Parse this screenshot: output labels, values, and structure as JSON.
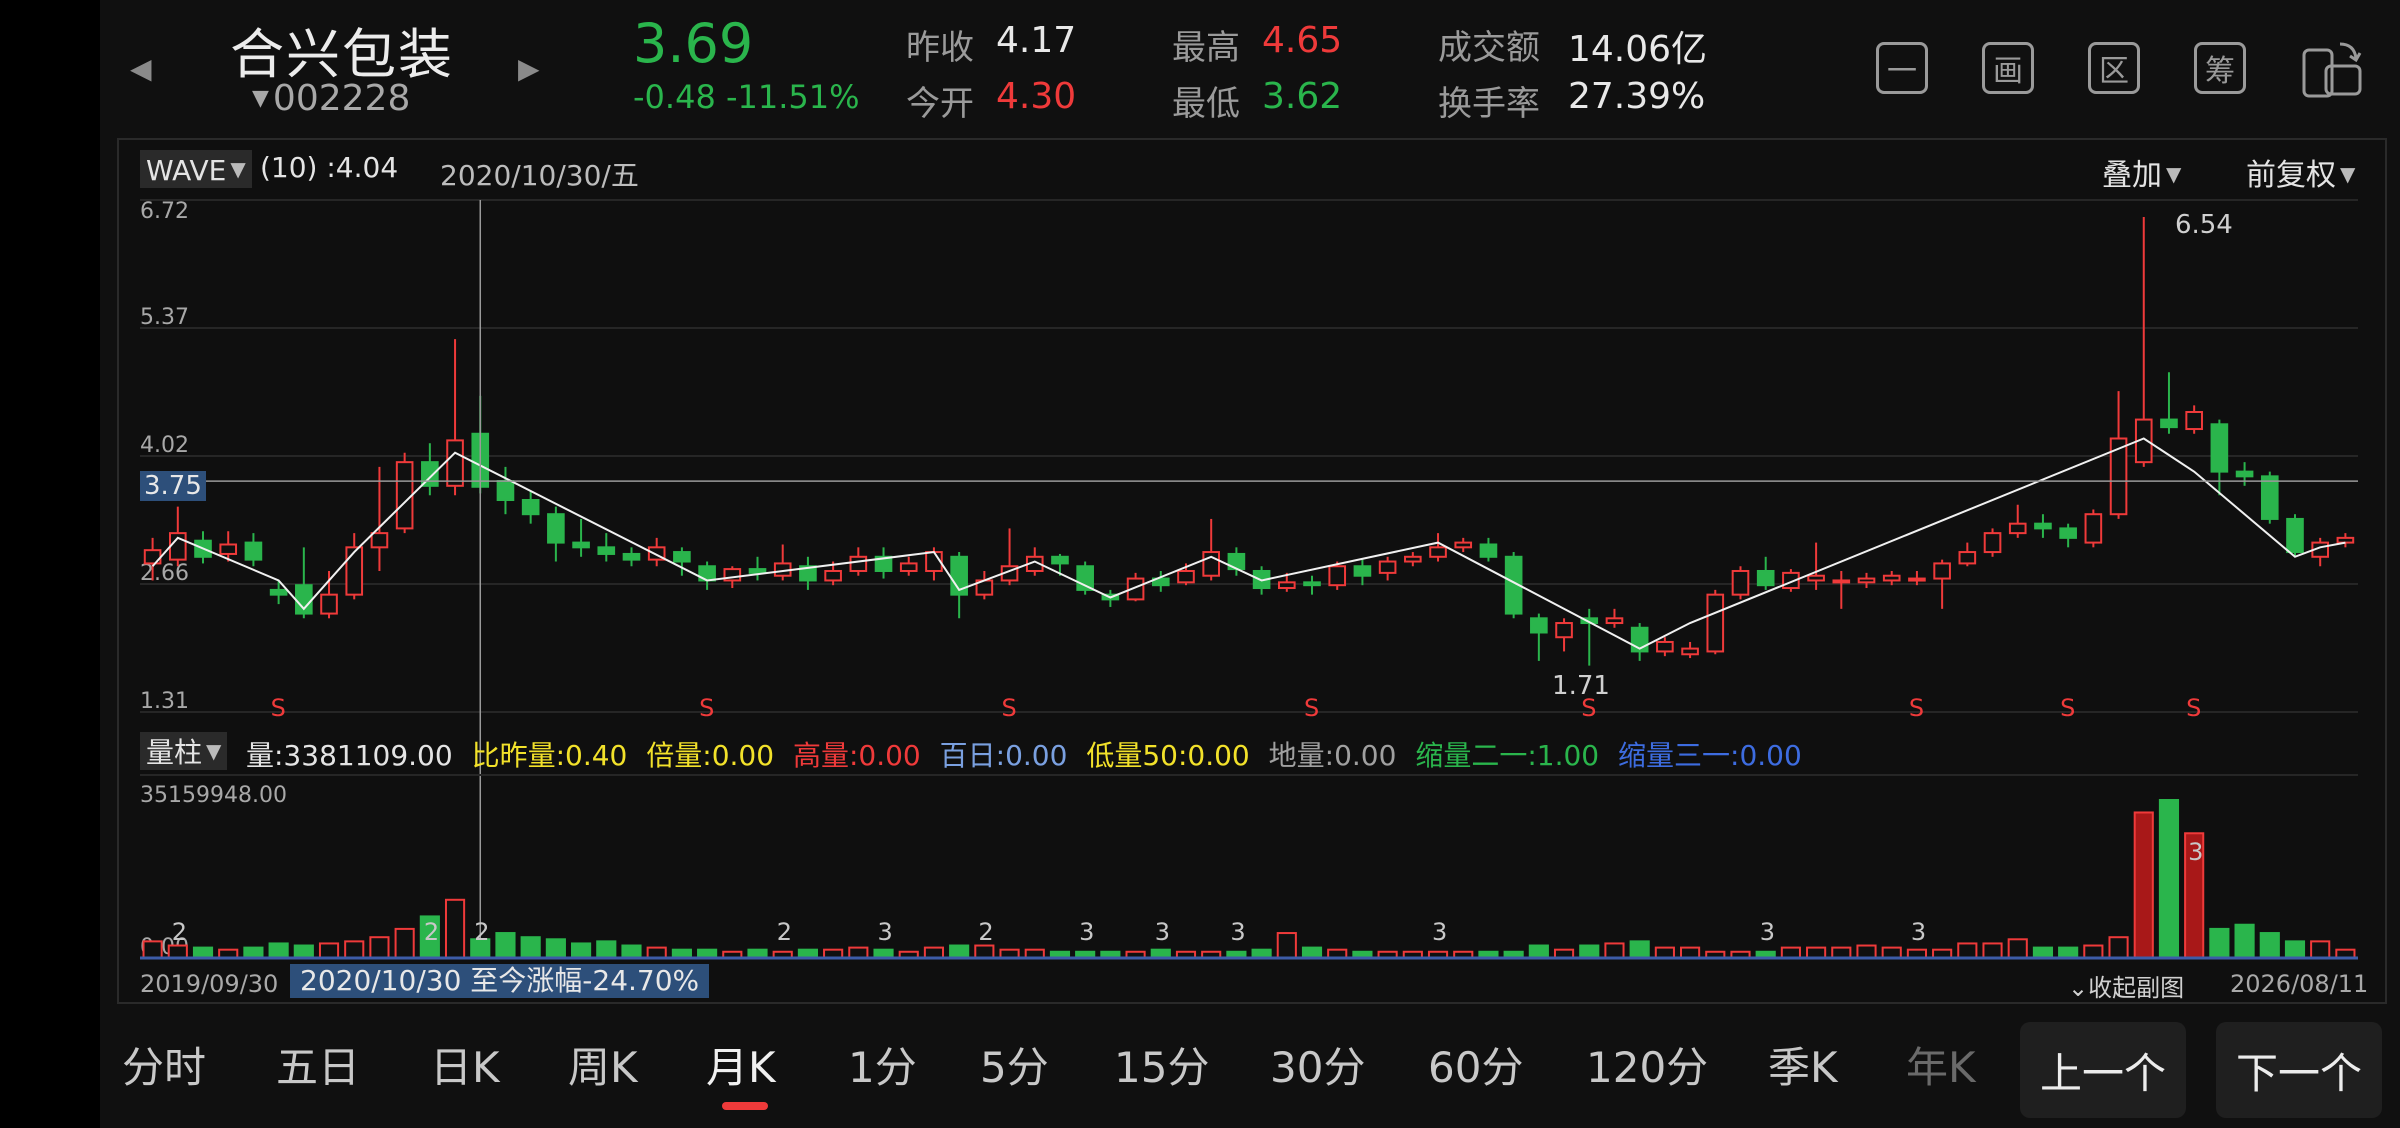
{
  "header": {
    "stock_name": "合兴包装",
    "stock_code": "002228",
    "price": "3.69",
    "change": "-0.48",
    "change_pct": "-11.51%",
    "prev_close_label": "昨收",
    "prev_close": "4.17",
    "open_label": "今开",
    "open": "4.30",
    "high_label": "最高",
    "high": "4.65",
    "low_label": "最低",
    "low": "3.62",
    "turnover_label": "成交额",
    "turnover": "14.06亿",
    "turnover_rate_label": "换手率",
    "turnover_rate": "27.39%",
    "tools": [
      "一",
      "画",
      "区",
      "筹"
    ]
  },
  "chart": {
    "indicator": "WAVE",
    "indicator_param": "(10) :4.04",
    "date": "2020/10/30/五",
    "overlay": "叠加",
    "adjust": "前复权",
    "price_tag": "3.75",
    "y_ticks": [
      "6.72",
      "5.37",
      "4.02",
      "2.66",
      "1.31"
    ],
    "annot_high": "6.54",
    "annot_low": "1.71",
    "s_marker": "S"
  },
  "volume": {
    "selector": "量柱",
    "ind_vol": "量:3381109.00",
    "ind_ratio": "比昨量:0.40",
    "ind_times": "倍量:0.00",
    "ind_high": "高量:0.00",
    "ind_100": "百日:0.00",
    "ind_low50": "低量50:0.00",
    "ind_ground": "地量:0.00",
    "ind_shrink2": "缩量二一:1.00",
    "ind_shrink3": "缩量三一:0.00",
    "max_label": "35159948.00",
    "min_label": "0.00",
    "marker_2": "2",
    "marker_3": "3"
  },
  "footer": {
    "start_date": "2019/09/30",
    "end_date": "2026/08/11",
    "range_text": "2020/10/30 至今涨幅-24.70%",
    "collapse": "收起副图"
  },
  "tabs": [
    "分时",
    "五日",
    "日K",
    "周K",
    "月K",
    "1分",
    "5分",
    "15分",
    "30分",
    "60分",
    "120分",
    "季K",
    "年K"
  ],
  "prev_btn": "上一个",
  "next_btn": "下一个",
  "chart_data": {
    "type": "candlestick",
    "period": "month",
    "x_range": [
      "2019/09/30",
      "2026/08/11"
    ],
    "ylim": [
      1.31,
      6.72
    ],
    "candles": [
      {
        "o": 2.88,
        "c": 3.02,
        "h": 3.15,
        "l": 2.7
      },
      {
        "o": 2.92,
        "c": 3.2,
        "h": 3.48,
        "l": 2.85
      },
      {
        "o": 3.12,
        "c": 2.95,
        "h": 3.22,
        "l": 2.88
      },
      {
        "o": 2.98,
        "c": 3.08,
        "h": 3.22,
        "l": 2.9
      },
      {
        "o": 3.1,
        "c": 2.92,
        "h": 3.2,
        "l": 2.85
      },
      {
        "o": 2.6,
        "c": 2.55,
        "h": 2.7,
        "l": 2.45
      },
      {
        "o": 2.65,
        "c": 2.35,
        "h": 3.05,
        "l": 2.3
      },
      {
        "o": 2.35,
        "c": 2.55,
        "h": 2.8,
        "l": 2.3
      },
      {
        "o": 2.55,
        "c": 3.05,
        "h": 3.2,
        "l": 2.5
      },
      {
        "o": 3.05,
        "c": 3.2,
        "h": 3.9,
        "l": 2.8
      },
      {
        "o": 3.25,
        "c": 3.95,
        "h": 4.05,
        "l": 3.2
      },
      {
        "o": 3.95,
        "c": 3.7,
        "h": 4.15,
        "l": 3.6
      },
      {
        "o": 3.7,
        "c": 4.18,
        "h": 5.25,
        "l": 3.6
      },
      {
        "o": 4.25,
        "c": 3.69,
        "h": 4.65,
        "l": 3.62
      },
      {
        "o": 3.75,
        "c": 3.55,
        "h": 3.9,
        "l": 3.4
      },
      {
        "o": 3.55,
        "c": 3.4,
        "h": 3.65,
        "l": 3.3
      },
      {
        "o": 3.4,
        "c": 3.1,
        "h": 3.48,
        "l": 2.9
      },
      {
        "o": 3.1,
        "c": 3.05,
        "h": 3.35,
        "l": 2.95
      },
      {
        "o": 3.05,
        "c": 2.98,
        "h": 3.2,
        "l": 2.9
      },
      {
        "o": 2.98,
        "c": 2.92,
        "h": 3.05,
        "l": 2.85
      },
      {
        "o": 2.92,
        "c": 3.05,
        "h": 3.15,
        "l": 2.85
      },
      {
        "o": 3.0,
        "c": 2.9,
        "h": 3.05,
        "l": 2.75
      },
      {
        "o": 2.85,
        "c": 2.7,
        "h": 2.9,
        "l": 2.6
      },
      {
        "o": 2.7,
        "c": 2.82,
        "h": 2.85,
        "l": 2.62
      },
      {
        "o": 2.82,
        "c": 2.78,
        "h": 2.95,
        "l": 2.7
      },
      {
        "o": 2.75,
        "c": 2.88,
        "h": 3.08,
        "l": 2.7
      },
      {
        "o": 2.85,
        "c": 2.7,
        "h": 2.95,
        "l": 2.6
      },
      {
        "o": 2.7,
        "c": 2.8,
        "h": 2.9,
        "l": 2.65
      },
      {
        "o": 2.8,
        "c": 2.95,
        "h": 3.05,
        "l": 2.75
      },
      {
        "o": 2.95,
        "c": 2.8,
        "h": 3.05,
        "l": 2.72
      },
      {
        "o": 2.8,
        "c": 2.88,
        "h": 2.95,
        "l": 2.75
      },
      {
        "o": 2.8,
        "c": 3.0,
        "h": 3.05,
        "l": 2.7
      },
      {
        "o": 2.95,
        "c": 2.55,
        "h": 3.0,
        "l": 2.3
      },
      {
        "o": 2.55,
        "c": 2.7,
        "h": 2.8,
        "l": 2.5
      },
      {
        "o": 2.7,
        "c": 2.85,
        "h": 3.25,
        "l": 2.65
      },
      {
        "o": 2.8,
        "c": 2.95,
        "h": 3.05,
        "l": 2.75
      },
      {
        "o": 2.95,
        "c": 2.88,
        "h": 2.98,
        "l": 2.75
      },
      {
        "o": 2.85,
        "c": 2.6,
        "h": 2.9,
        "l": 2.55
      },
      {
        "o": 2.55,
        "c": 2.5,
        "h": 2.6,
        "l": 2.42
      },
      {
        "o": 2.5,
        "c": 2.72,
        "h": 2.78,
        "l": 2.48
      },
      {
        "o": 2.72,
        "c": 2.65,
        "h": 2.8,
        "l": 2.58
      },
      {
        "o": 2.68,
        "c": 2.8,
        "h": 2.88,
        "l": 2.65
      },
      {
        "o": 2.75,
        "c": 3.0,
        "h": 3.35,
        "l": 2.7
      },
      {
        "o": 2.98,
        "c": 2.82,
        "h": 3.05,
        "l": 2.75
      },
      {
        "o": 2.8,
        "c": 2.62,
        "h": 2.85,
        "l": 2.55
      },
      {
        "o": 2.62,
        "c": 2.68,
        "h": 2.78,
        "l": 2.58
      },
      {
        "o": 2.68,
        "c": 2.65,
        "h": 2.75,
        "l": 2.55
      },
      {
        "o": 2.65,
        "c": 2.85,
        "h": 2.9,
        "l": 2.6
      },
      {
        "o": 2.85,
        "c": 2.75,
        "h": 2.92,
        "l": 2.65
      },
      {
        "o": 2.78,
        "c": 2.9,
        "h": 2.95,
        "l": 2.7
      },
      {
        "o": 2.9,
        "c": 2.95,
        "h": 3.0,
        "l": 2.85
      },
      {
        "o": 2.95,
        "c": 3.05,
        "h": 3.2,
        "l": 2.9
      },
      {
        "o": 3.05,
        "c": 3.1,
        "h": 3.15,
        "l": 3.0
      },
      {
        "o": 3.08,
        "c": 2.95,
        "h": 3.15,
        "l": 2.9
      },
      {
        "o": 2.95,
        "c": 2.35,
        "h": 3.0,
        "l": 2.3
      },
      {
        "o": 2.3,
        "c": 2.15,
        "h": 2.35,
        "l": 1.85
      },
      {
        "o": 2.1,
        "c": 2.25,
        "h": 2.3,
        "l": 1.95
      },
      {
        "o": 2.3,
        "c": 2.25,
        "h": 2.4,
        "l": 1.8
      },
      {
        "o": 2.25,
        "c": 2.3,
        "h": 2.4,
        "l": 2.2
      },
      {
        "o": 2.2,
        "c": 1.95,
        "h": 2.25,
        "l": 1.85
      },
      {
        "o": 1.95,
        "c": 2.05,
        "h": 2.1,
        "l": 1.9
      },
      {
        "o": 1.92,
        "c": 1.98,
        "h": 2.05,
        "l": 1.88
      },
      {
        "o": 1.95,
        "c": 2.55,
        "h": 2.6,
        "l": 1.92
      },
      {
        "o": 2.55,
        "c": 2.8,
        "h": 2.85,
        "l": 2.5
      },
      {
        "o": 2.8,
        "c": 2.65,
        "h": 2.95,
        "l": 2.6
      },
      {
        "o": 2.62,
        "c": 2.78,
        "h": 2.82,
        "l": 2.58
      },
      {
        "o": 2.7,
        "c": 2.75,
        "h": 3.1,
        "l": 2.6
      },
      {
        "o": 2.7,
        "c": 2.7,
        "h": 2.8,
        "l": 2.4
      },
      {
        "o": 2.68,
        "c": 2.72,
        "h": 2.78,
        "l": 2.62
      },
      {
        "o": 2.7,
        "c": 2.75,
        "h": 2.8,
        "l": 2.65
      },
      {
        "o": 2.7,
        "c": 2.72,
        "h": 2.8,
        "l": 2.65
      },
      {
        "o": 2.72,
        "c": 2.88,
        "h": 2.92,
        "l": 2.4
      },
      {
        "o": 2.88,
        "c": 3.0,
        "h": 3.1,
        "l": 2.85
      },
      {
        "o": 3.0,
        "c": 3.2,
        "h": 3.25,
        "l": 2.95
      },
      {
        "o": 3.2,
        "c": 3.3,
        "h": 3.5,
        "l": 3.15
      },
      {
        "o": 3.3,
        "c": 3.25,
        "h": 3.4,
        "l": 3.15
      },
      {
        "o": 3.25,
        "c": 3.15,
        "h": 3.3,
        "l": 3.05
      },
      {
        "o": 3.1,
        "c": 3.4,
        "h": 3.45,
        "l": 3.05
      },
      {
        "o": 3.4,
        "c": 4.2,
        "h": 4.7,
        "l": 3.35
      },
      {
        "o": 3.95,
        "c": 4.4,
        "h": 6.54,
        "l": 3.9
      },
      {
        "o": 4.4,
        "c": 4.32,
        "h": 4.9,
        "l": 4.25
      },
      {
        "o": 4.3,
        "c": 4.48,
        "h": 4.55,
        "l": 4.25
      },
      {
        "o": 4.35,
        "c": 3.85,
        "h": 4.4,
        "l": 3.6
      },
      {
        "o": 3.85,
        "c": 3.8,
        "h": 3.95,
        "l": 3.7
      },
      {
        "o": 3.8,
        "c": 3.35,
        "h": 3.85,
        "l": 3.3
      },
      {
        "o": 3.35,
        "c": 3.0,
        "h": 3.4,
        "l": 2.95
      },
      {
        "o": 2.95,
        "c": 3.1,
        "h": 3.15,
        "l": 2.85
      },
      {
        "o": 3.1,
        "c": 3.15,
        "h": 3.2,
        "l": 3.05
      }
    ],
    "wave_line": [
      {
        "i": 0,
        "v": 2.85
      },
      {
        "i": 1,
        "v": 3.15
      },
      {
        "i": 5,
        "v": 2.7
      },
      {
        "i": 6,
        "v": 2.4
      },
      {
        "i": 8,
        "v": 3.0
      },
      {
        "i": 12,
        "v": 4.05
      },
      {
        "i": 22,
        "v": 2.7
      },
      {
        "i": 31,
        "v": 3.0
      },
      {
        "i": 32,
        "v": 2.6
      },
      {
        "i": 35,
        "v": 2.9
      },
      {
        "i": 38,
        "v": 2.52
      },
      {
        "i": 42,
        "v": 2.95
      },
      {
        "i": 44,
        "v": 2.7
      },
      {
        "i": 51,
        "v": 3.1
      },
      {
        "i": 59,
        "v": 1.98
      },
      {
        "i": 61,
        "v": 2.25
      },
      {
        "i": 79,
        "v": 4.2
      },
      {
        "i": 81,
        "v": 3.85
      },
      {
        "i": 85,
        "v": 2.95
      },
      {
        "i": 86,
        "v": 3.05
      },
      {
        "i": 87,
        "v": 3.1
      }
    ],
    "volume": [
      8,
      6,
      5,
      4,
      5,
      7,
      6,
      7,
      8,
      10,
      14,
      20,
      28,
      9,
      12,
      10,
      9,
      7,
      8,
      6,
      5,
      4,
      4,
      3,
      4,
      3,
      4,
      4,
      5,
      4,
      3,
      5,
      6,
      6,
      4,
      4,
      3,
      3,
      3,
      3,
      4,
      3,
      3,
      3,
      4,
      12,
      5,
      4,
      3,
      3,
      3,
      3,
      3,
      3,
      3,
      6,
      4,
      6,
      7,
      8,
      5,
      5,
      3,
      3,
      3,
      5,
      5,
      5,
      6,
      5,
      4,
      4,
      7,
      7,
      9,
      5,
      5,
      6,
      10,
      70,
      76,
      60,
      14,
      16,
      12,
      8,
      8,
      4
    ]
  }
}
